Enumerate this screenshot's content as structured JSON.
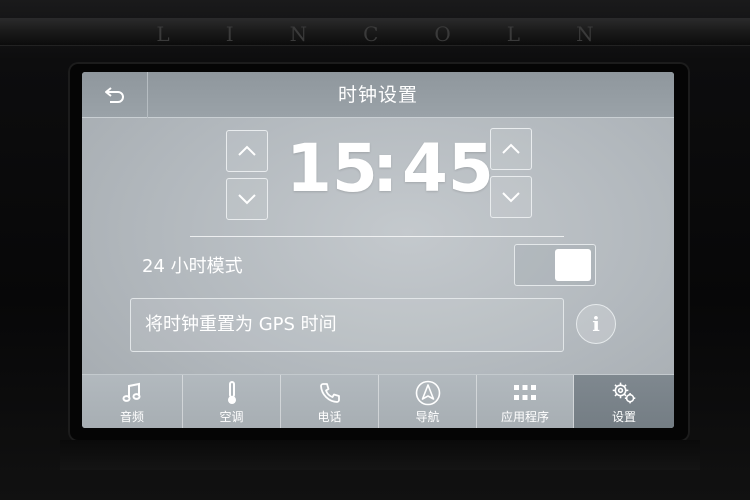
{
  "device": {
    "brand": "LINCOLN"
  },
  "header": {
    "title": "时钟设置",
    "back_icon": "back-arrow-icon"
  },
  "clock": {
    "hours": "15",
    "separator": ":",
    "minutes": "45"
  },
  "mode": {
    "label": "24 小时模式",
    "enabled": true
  },
  "gps_reset": {
    "label": "将时钟重置为 GPS 时间",
    "info_icon_text": "i"
  },
  "nav": {
    "items": [
      {
        "label": "音频",
        "icon": "music-note-icon",
        "active": false
      },
      {
        "label": "空调",
        "icon": "thermometer-icon",
        "active": false
      },
      {
        "label": "电话",
        "icon": "phone-icon",
        "active": false
      },
      {
        "label": "导航",
        "icon": "navigation-icon",
        "active": false
      },
      {
        "label": "应用程序",
        "icon": "apps-grid-icon",
        "active": false
      },
      {
        "label": "设置",
        "icon": "gears-icon",
        "active": true
      }
    ]
  },
  "colors": {
    "screen_bg": "#b8bec3",
    "header_bg": "#939ba1",
    "active_tab": "#7a838a",
    "text": "#ffffff"
  }
}
